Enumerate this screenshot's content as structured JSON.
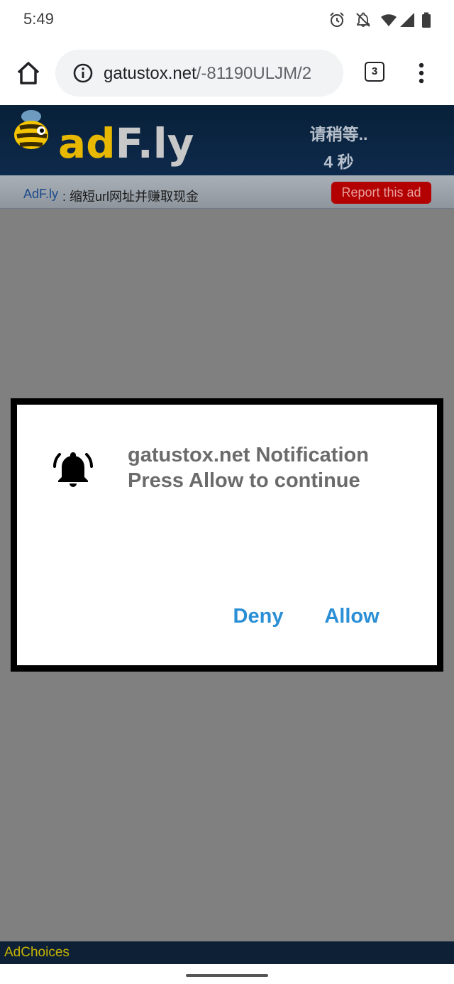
{
  "status_bar": {
    "time": "5:49",
    "icons": [
      "alarm-icon",
      "notifications-off-icon",
      "wifi-icon",
      "signal-icon",
      "battery-icon"
    ]
  },
  "browser": {
    "url_domain": "gatustox.net",
    "url_path": "/-81190ULJM/2",
    "tab_count": "3",
    "icons": [
      "home-icon",
      "info-icon",
      "more-vert-icon"
    ]
  },
  "adfly": {
    "logo_text": "adf.ly",
    "wait_text": "请稍等..",
    "countdown_text": "4 秒",
    "site_link": "AdF.ly",
    "tagline": " : 缩短url网址并赚取现金",
    "report_label": "Report this ad"
  },
  "dialog": {
    "title": "gatustox.net Notification",
    "message": "Press Allow to continue",
    "deny_label": "Deny",
    "allow_label": "Allow",
    "icon": "bell-icon"
  },
  "footer": {
    "adchoices_label": "AdChoices"
  },
  "colors": {
    "overlay": "#808080",
    "adfly_header": "#0c2340",
    "report_button": "#b30000",
    "dialog_button_text": "#2b8fd6",
    "adchoices_text": "#c8b400"
  }
}
